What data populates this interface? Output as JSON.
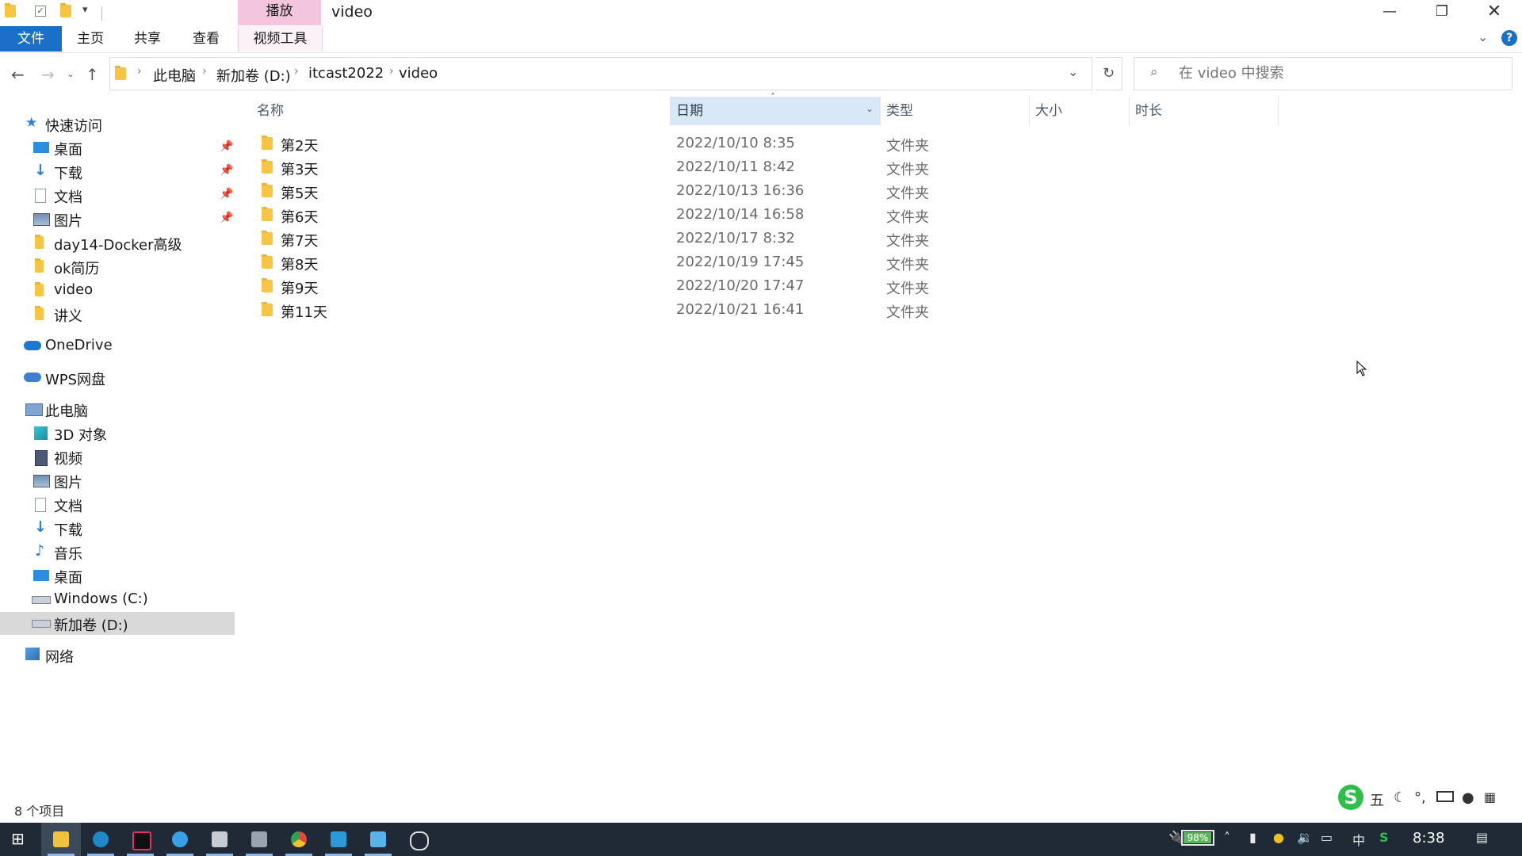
{
  "window": {
    "title": "video",
    "context_tab": "播放",
    "quick_access_icons": [
      "folder-icon",
      "properties-check-icon",
      "new-folder-icon",
      "customize-dropdown-icon"
    ],
    "controls": [
      "minimize-icon",
      "restore-icon",
      "close-icon"
    ]
  },
  "ribbon": {
    "tabs": [
      "文件",
      "主页",
      "共享",
      "查看"
    ],
    "context_tab_label": "视频工具",
    "file_tab_color": "#1a6fc6",
    "context_color": "#f3c6de"
  },
  "address": {
    "breadcrumbs": [
      "此电脑",
      "新加卷 (D:)",
      "itcast2022",
      "video"
    ]
  },
  "search": {
    "placeholder": "在 video 中搜索"
  },
  "sidebar": {
    "quick_access": {
      "label": "快速访问",
      "items": [
        {
          "label": "桌面",
          "icon": "desktop-icon",
          "pinned": true
        },
        {
          "label": "下载",
          "icon": "download-icon",
          "pinned": true
        },
        {
          "label": "文档",
          "icon": "document-icon",
          "pinned": true
        },
        {
          "label": "图片",
          "icon": "pictures-icon",
          "pinned": true
        },
        {
          "label": "day14-Docker高级",
          "icon": "folder-icon",
          "pinned": false
        },
        {
          "label": "ok简历",
          "icon": "folder-icon",
          "pinned": false
        },
        {
          "label": "video",
          "icon": "folder-icon",
          "pinned": false
        },
        {
          "label": "讲义",
          "icon": "folder-icon",
          "pinned": false
        }
      ]
    },
    "onedrive": "OneDrive",
    "wps": "WPS网盘",
    "this_pc": {
      "label": "此电脑",
      "items": [
        {
          "label": "3D 对象",
          "icon": "3d-objects-icon"
        },
        {
          "label": "视频",
          "icon": "videos-icon"
        },
        {
          "label": "图片",
          "icon": "pictures-icon"
        },
        {
          "label": "文档",
          "icon": "document-icon"
        },
        {
          "label": "下载",
          "icon": "download-icon"
        },
        {
          "label": "音乐",
          "icon": "music-icon"
        },
        {
          "label": "桌面",
          "icon": "desktop-icon"
        },
        {
          "label": "Windows (C:)",
          "icon": "drive-c-icon"
        },
        {
          "label": "新加卷 (D:)",
          "icon": "drive-d-icon",
          "selected": true
        }
      ]
    },
    "network": "网络"
  },
  "file_list": {
    "columns": [
      "名称",
      "日期",
      "类型",
      "大小",
      "时长"
    ],
    "sorted_column": "日期",
    "rows": [
      {
        "name": "第2天",
        "date": "2022/10/10 8:35",
        "type": "文件夹"
      },
      {
        "name": "第3天",
        "date": "2022/10/11 8:42",
        "type": "文件夹"
      },
      {
        "name": "第5天",
        "date": "2022/10/13 16:36",
        "type": "文件夹"
      },
      {
        "name": "第6天",
        "date": "2022/10/14 16:58",
        "type": "文件夹"
      },
      {
        "name": "第7天",
        "date": "2022/10/17 8:32",
        "type": "文件夹"
      },
      {
        "name": "第8天",
        "date": "2022/10/19 17:45",
        "type": "文件夹"
      },
      {
        "name": "第9天",
        "date": "2022/10/20 17:47",
        "type": "文件夹"
      },
      {
        "name": "第11天",
        "date": "2022/10/21 16:41",
        "type": "文件夹"
      }
    ]
  },
  "status_bar": {
    "item_count": "8 个项目"
  },
  "ime": {
    "mode": "五",
    "icons": [
      "sogou-logo-icon",
      "moon-icon",
      "punctuation-icon",
      "keyboard-icon",
      "user-icon",
      "grid-icon"
    ]
  },
  "taskbar": {
    "apps": [
      "start-icon",
      "file-explorer-icon",
      "edge-icon",
      "intellij-icon",
      "browser-icon",
      "notes-icon",
      "app-icon",
      "chrome-icon",
      "screen-tool-icon",
      "photos-icon",
      "obs-icon"
    ],
    "battery_percent": "98%",
    "battery_level": 0.98,
    "ime_lang": "中",
    "clock": "8:38"
  }
}
